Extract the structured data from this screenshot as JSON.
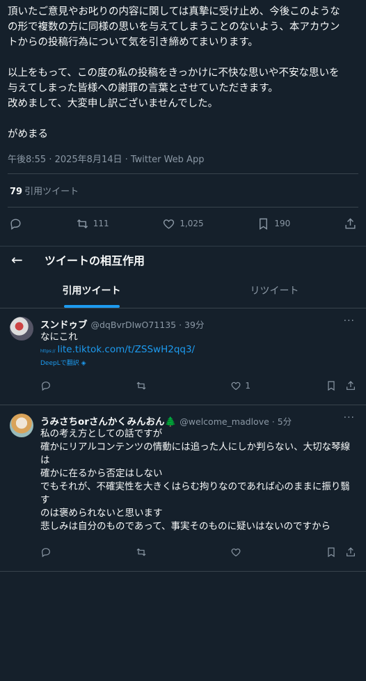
{
  "tweet": {
    "body": "頂いたご意見やお叱りの内容に関しては真摯に受け止め、今後このような\nの形で複数の方に同様の思いを与えてしまうことのないよう、本アカウン\nトからの投稿行為について気を引き締めてまいります。\n\n以上をもって、この度の私の投稿をきっかけに不快な思いや不安な思いを\n与えてしまった皆様への謝罪の言葉とさせていただきます。\n改めまして、大変申し訳ございませんでした。\n\nがめまる",
    "meta": "午後8:55 · 2025年8月14日 · Twitter Web App",
    "quote_count": "79",
    "quote_label": "引用ツイート",
    "retweets": "111",
    "likes": "1,025",
    "bookmarks": "190"
  },
  "panel": {
    "title": "ツイートの相互作用",
    "tabs": [
      "引用ツイート",
      "リツイート"
    ]
  },
  "replies": [
    {
      "name": "スンドゥブ",
      "handle": "@dqBvrDIwO71135 · 39分",
      "text": "なにこれ",
      "link_prefix": "https://",
      "link": "lite.tiktok.com/t/ZSSwH2qq3/",
      "deepl": "DeepLで翻訳",
      "likes": "1"
    },
    {
      "name": "うみさちorさんかくみんおん🌲",
      "handle": "@welcome_madlove · 5分",
      "text": "私の考え方としての話ですが\n確かにリアルコンテンツの情動には追った人にしか判らない、大切な琴線は\n確かに在るから否定はしない\nでもそれが、不確実性を大きくはらむ拘りなのであれば心のままに振り翳す\nのは褒められないと思います\n悲しみは自分のものであって、事実そのものに疑いはないのですから"
    }
  ]
}
